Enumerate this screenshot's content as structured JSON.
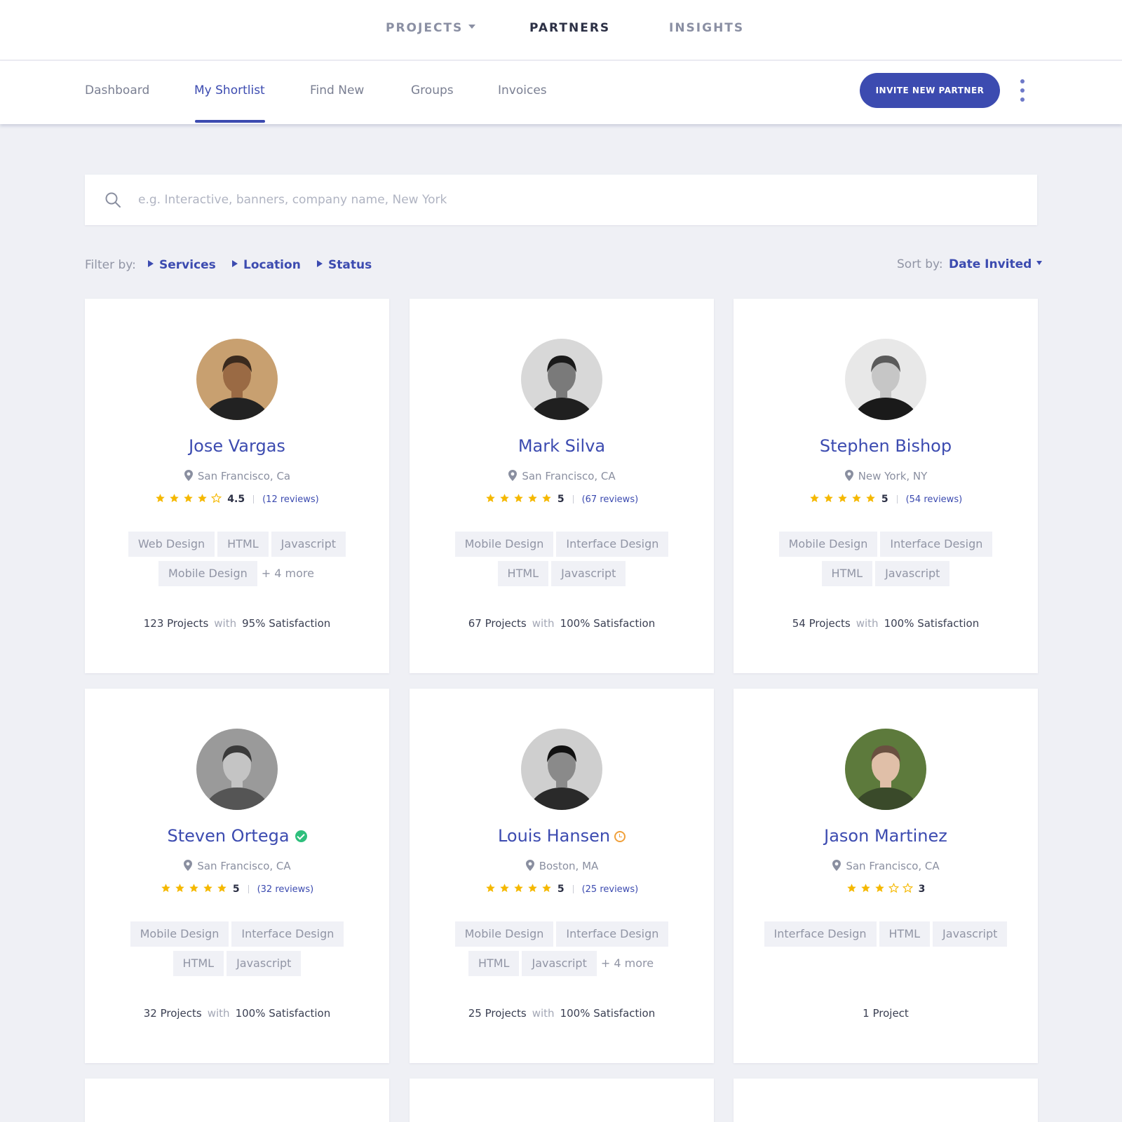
{
  "top_nav": {
    "items": [
      {
        "label": "PROJECTS",
        "has_caret": true
      },
      {
        "label": "PARTNERS",
        "active": true
      },
      {
        "label": "INSIGHTS"
      }
    ]
  },
  "sub_nav": {
    "tabs": [
      "Dashboard",
      "My Shortlist",
      "Find New",
      "Groups",
      "Invoices"
    ],
    "active_tab": "My Shortlist",
    "invite_button": "INVITE NEW PARTNER"
  },
  "search": {
    "placeholder": "e.g. Interactive, banners, company name, New York",
    "value": ""
  },
  "filters": {
    "label": "Filter by:",
    "items": [
      "Services",
      "Location",
      "Status"
    ]
  },
  "sort": {
    "label": "Sort by:",
    "value": "Date Invited"
  },
  "colors": {
    "accent": "#3c4bb0",
    "star": "#f5b800",
    "verified": "#2ebf7c",
    "pending": "#f0a03a"
  },
  "partners": [
    {
      "name": "Jose Vargas",
      "location": "San Francisco, Ca",
      "rating": 4.5,
      "rating_text": "4.5",
      "reviews": "(12 reviews)",
      "tags": [
        "Web Design",
        "HTML",
        "Javascript",
        "Mobile Design"
      ],
      "more": "+ 4 more",
      "projects": "123 Projects",
      "with": "with",
      "satisfaction": "95% Satisfaction",
      "badge": null
    },
    {
      "name": "Mark Silva",
      "location": "San Francisco, CA",
      "rating": 5,
      "rating_text": "5",
      "reviews": "(67 reviews)",
      "tags": [
        "Mobile Design",
        "Interface Design",
        "HTML",
        "Javascript"
      ],
      "more": "",
      "projects": "67 Projects",
      "with": "with",
      "satisfaction": "100% Satisfaction",
      "badge": null
    },
    {
      "name": "Stephen Bishop",
      "location": "New York, NY",
      "rating": 5,
      "rating_text": "5",
      "reviews": "(54 reviews)",
      "tags": [
        "Mobile Design",
        "Interface Design",
        "HTML",
        "Javascript"
      ],
      "more": "",
      "projects": "54 Projects",
      "with": "with",
      "satisfaction": "100% Satisfaction",
      "badge": null
    },
    {
      "name": "Steven Ortega",
      "location": "San Francisco, CA",
      "rating": 5,
      "rating_text": "5",
      "reviews": "(32 reviews)",
      "tags": [
        "Mobile Design",
        "Interface Design",
        "HTML",
        "Javascript"
      ],
      "more": "",
      "projects": "32 Projects",
      "with": "with",
      "satisfaction": "100% Satisfaction",
      "badge": "verified"
    },
    {
      "name": "Louis Hansen",
      "location": "Boston, MA",
      "rating": 5,
      "rating_text": "5",
      "reviews": "(25 reviews)",
      "tags": [
        "Mobile Design",
        "Interface Design",
        "HTML",
        "Javascript"
      ],
      "more": "+ 4 more",
      "projects": "25 Projects",
      "with": "with",
      "satisfaction": "100% Satisfaction",
      "badge": "pending"
    },
    {
      "name": "Jason Martinez",
      "location": "San Francisco, CA",
      "rating": 3,
      "rating_text": "3",
      "reviews": "",
      "tags": [
        "Interface Design",
        "HTML",
        "Javascript"
      ],
      "more": "",
      "projects": "1 Project",
      "with": "",
      "satisfaction": "",
      "badge": null
    }
  ]
}
